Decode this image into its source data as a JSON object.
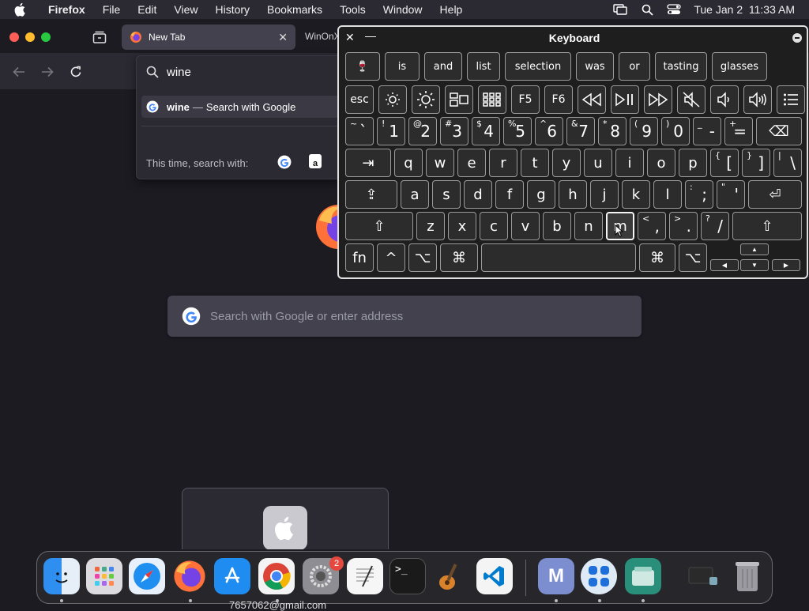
{
  "menubar": {
    "app_name": "Firefox",
    "items": [
      "File",
      "Edit",
      "View",
      "History",
      "Bookmarks",
      "Tools",
      "Window",
      "Help"
    ],
    "clock": "Tue Jan 2  11:33 AM"
  },
  "browser": {
    "tabs": [
      {
        "label": "New Tab",
        "active": true
      },
      {
        "label": "WinOnX",
        "active": false
      }
    ],
    "url_input": "wine",
    "suggestion": {
      "term": "wine",
      "separator": "—",
      "action": "Search with Google"
    },
    "search_with_label": "This time, search with:",
    "search_placeholder": "Search with Google or enter address"
  },
  "keyboard_viewer": {
    "title": "Keyboard",
    "suggestions": [
      "🍷",
      "is",
      "and",
      "list",
      "selection",
      "was",
      "or",
      "tasting",
      "glasses"
    ],
    "fn_row": [
      "esc",
      "brightness-down-icon",
      "brightness-up-icon",
      "mission-control-icon",
      "launchpad-icon",
      "F5",
      "F6",
      "rewind-icon",
      "play-pause-icon",
      "fast-forward-icon",
      "mute-icon",
      "volume-down-icon",
      "volume-up-icon",
      "list-icon"
    ],
    "number_row": [
      {
        "shift": "~",
        "main": "`"
      },
      {
        "shift": "!",
        "main": "1"
      },
      {
        "shift": "@",
        "main": "2"
      },
      {
        "shift": "#",
        "main": "3"
      },
      {
        "shift": "$",
        "main": "4"
      },
      {
        "shift": "%",
        "main": "5"
      },
      {
        "shift": "^",
        "main": "6"
      },
      {
        "shift": "&",
        "main": "7"
      },
      {
        "shift": "*",
        "main": "8"
      },
      {
        "shift": "(",
        "main": "9"
      },
      {
        "shift": ")",
        "main": "0"
      },
      {
        "shift": "_",
        "main": "-"
      },
      {
        "shift": "+",
        "main": "="
      }
    ],
    "row_q": [
      "q",
      "w",
      "e",
      "r",
      "t",
      "y",
      "u",
      "i",
      "o",
      "p"
    ],
    "row_q_extra": [
      {
        "shift": "{",
        "main": "["
      },
      {
        "shift": "}",
        "main": "]"
      },
      {
        "shift": "|",
        "main": "\\"
      }
    ],
    "row_a": [
      "a",
      "s",
      "d",
      "f",
      "g",
      "h",
      "j",
      "k",
      "l"
    ],
    "row_a_extra": [
      {
        "shift": ":",
        "main": ";"
      },
      {
        "shift": "\"",
        "main": "'"
      }
    ],
    "row_z": [
      "z",
      "x",
      "c",
      "v",
      "b",
      "n",
      "m"
    ],
    "row_z_extra": [
      {
        "shift": "<",
        "main": ","
      },
      {
        "shift": ">",
        "main": "."
      },
      {
        "shift": "?",
        "main": "/"
      }
    ],
    "highlighted_key": "m",
    "bottom_row": [
      "fn",
      "^",
      "⌥",
      "⌘",
      "",
      "⌘",
      "⌥"
    ],
    "symbols": {
      "tab": "⇥",
      "caps": "⇪",
      "shift": "⇧",
      "return": "⏎",
      "delete": "⌫"
    }
  },
  "dock": {
    "apps": [
      "Finder",
      "Launchpad",
      "Safari",
      "Firefox",
      "App Store",
      "Chrome",
      "System Settings",
      "TextEdit",
      "Terminal",
      "GarageBand",
      "VS Code",
      "M",
      "Mirror",
      "Files"
    ],
    "settings_badge": "2",
    "under_text": "7657062@gmail.com"
  },
  "colors": {
    "accent": "#0060df",
    "keyboard_bg": "#1e1e1e",
    "window_bg": "#1c1b22",
    "toolbar": "#2b2a33"
  }
}
